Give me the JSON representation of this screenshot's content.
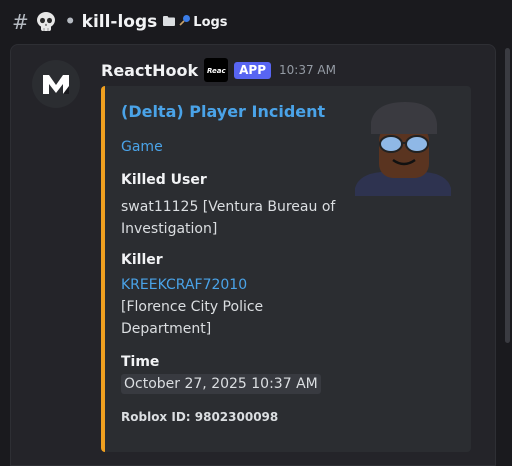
{
  "channel": {
    "hash": "#",
    "bullet": "•",
    "name": "kill-logs",
    "folder_icon": "folder-icon",
    "pin_icon": "pushpin-icon",
    "thread": "Logs"
  },
  "message": {
    "author": "ReactHook",
    "badge": "APP",
    "time": "10:37 AM",
    "embed": {
      "accent_color": "#f0a020",
      "title": "(Delta) Player Incident",
      "description": "Game",
      "fields": [
        {
          "name": "Killed User",
          "value": "swat11125 [Ventura Bureau of Investigation]"
        },
        {
          "name": "Killer",
          "link": "KREEKCRAF72010",
          "value": "[Florence City Police Department]"
        },
        {
          "name": "Time",
          "value": "October 27, 2025 10:37 AM"
        }
      ],
      "footer": "Roblox ID: 9802300098"
    }
  }
}
